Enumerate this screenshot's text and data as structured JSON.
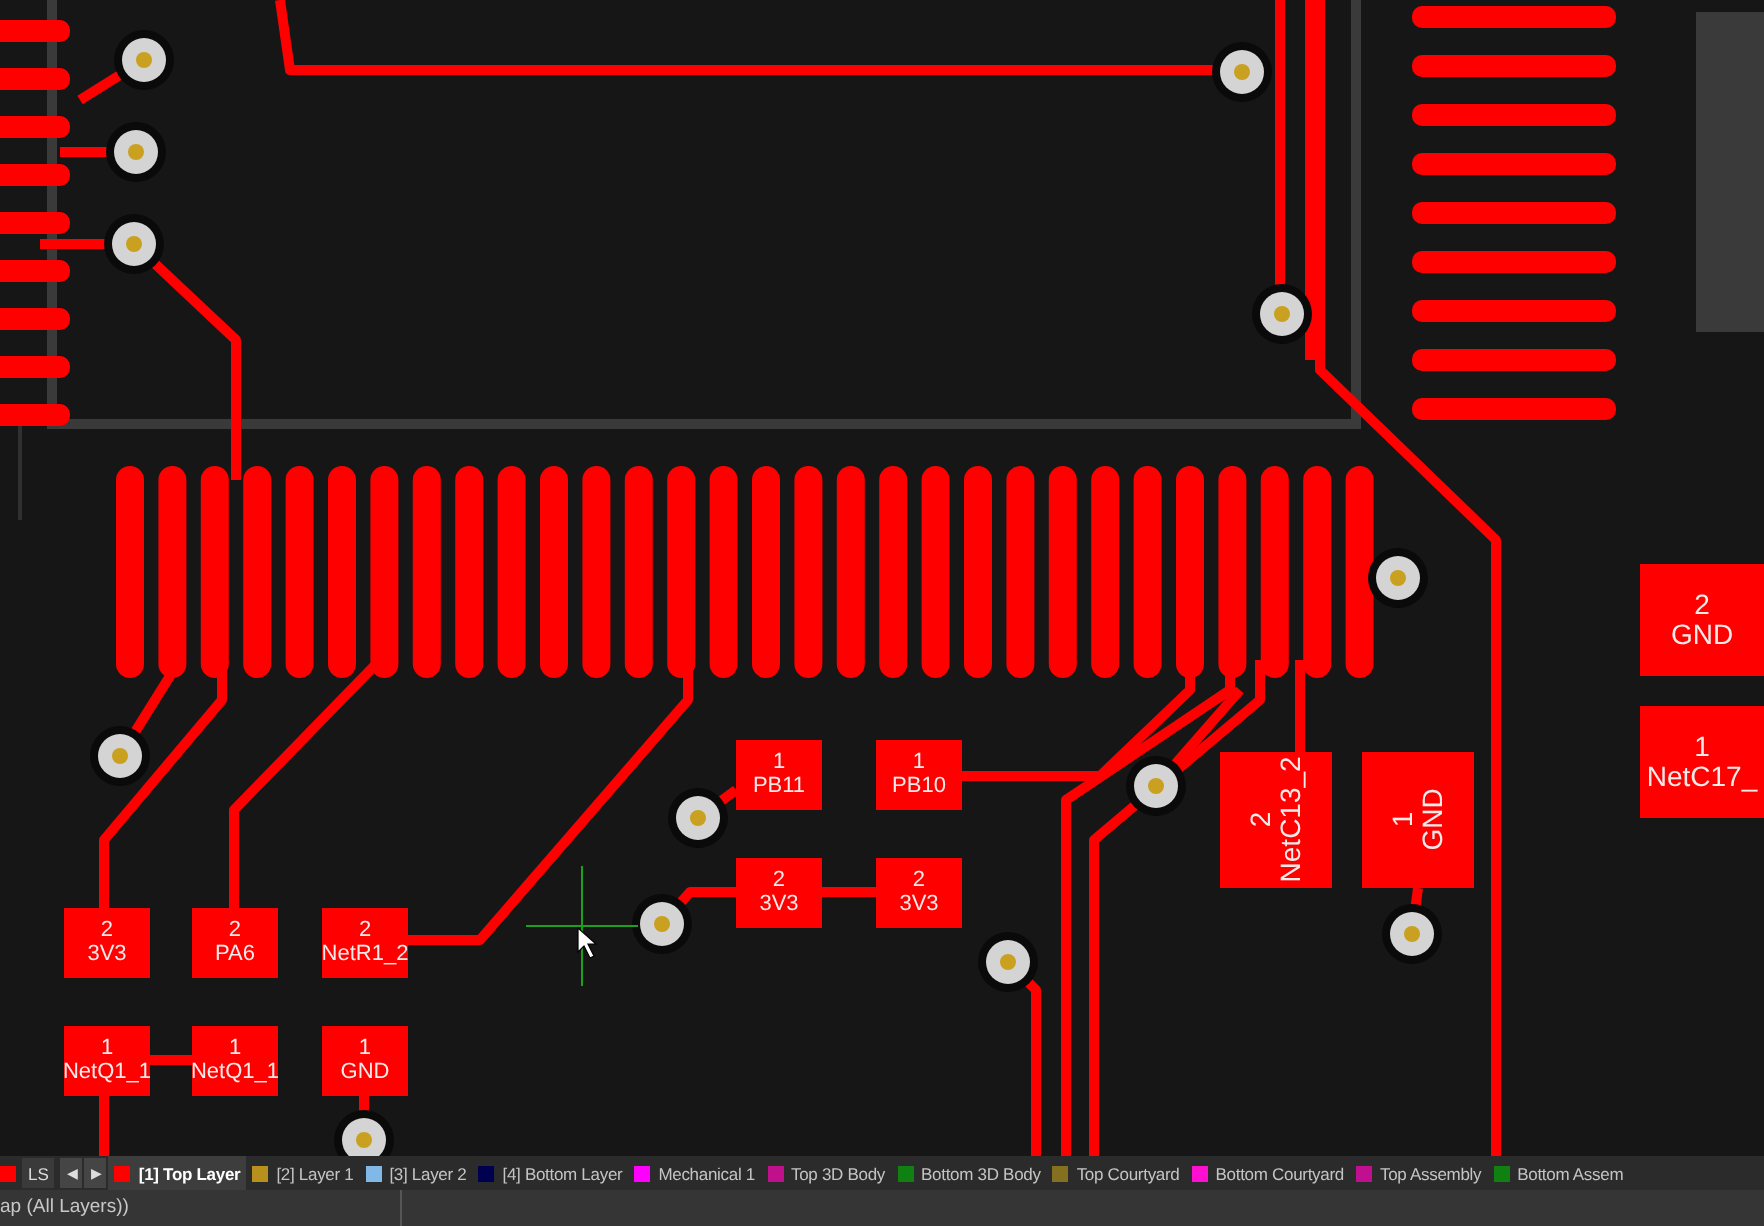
{
  "pads": [
    {
      "number": "2",
      "net": "3V3",
      "kind": "horizontal"
    },
    {
      "number": "2",
      "net": "PA6",
      "kind": "horizontal"
    },
    {
      "number": "2",
      "net": "NetR1_2",
      "kind": "horizontal"
    },
    {
      "number": "1",
      "net": "NetQ1_1",
      "kind": "horizontal"
    },
    {
      "number": "1",
      "net": "NetQ1_1",
      "kind": "horizontal"
    },
    {
      "number": "1",
      "net": "GND",
      "kind": "horizontal"
    },
    {
      "number": "1",
      "net": "PB11",
      "kind": "horizontal"
    },
    {
      "number": "1",
      "net": "PB10",
      "kind": "horizontal"
    },
    {
      "number": "2",
      "net": "3V3",
      "kind": "horizontal"
    },
    {
      "number": "2",
      "net": "3V3",
      "kind": "horizontal"
    },
    {
      "number": "2",
      "net": "NetC13_2",
      "kind": "vertical"
    },
    {
      "number": "1",
      "net": "GND",
      "kind": "vertical"
    },
    {
      "number": "2",
      "net": "GND",
      "kind": "horizontal"
    },
    {
      "number": "1",
      "net": "NetC17_",
      "kind": "horizontal"
    }
  ],
  "layer_bar": {
    "ls_button": "LS",
    "prev": "◀",
    "next": "▶",
    "layers": [
      {
        "label": "[1] Top Layer",
        "color": "#ff0000",
        "selected": true
      },
      {
        "label": "[2] Layer 1",
        "color": "#b8901c",
        "selected": false
      },
      {
        "label": "[3] Layer 2",
        "color": "#80b8e8",
        "selected": false
      },
      {
        "label": "[4] Bottom Layer",
        "color": "#000050",
        "selected": false
      },
      {
        "label": "Mechanical 1",
        "color": "#ff00ff",
        "selected": false
      },
      {
        "label": "Top 3D Body",
        "color": "#c0108c",
        "selected": false
      },
      {
        "label": "Bottom 3D Body",
        "color": "#108010",
        "selected": false
      },
      {
        "label": "Top Courtyard",
        "color": "#857020",
        "selected": false
      },
      {
        "label": "Bottom Courtyard",
        "color": "#ff10d0",
        "selected": false
      },
      {
        "label": "Top Assembly",
        "color": "#c01090",
        "selected": false
      },
      {
        "label": "Bottom Assem",
        "color": "#108010",
        "selected": false
      }
    ]
  },
  "status_bar": {
    "text": "ap (All Layers))"
  }
}
